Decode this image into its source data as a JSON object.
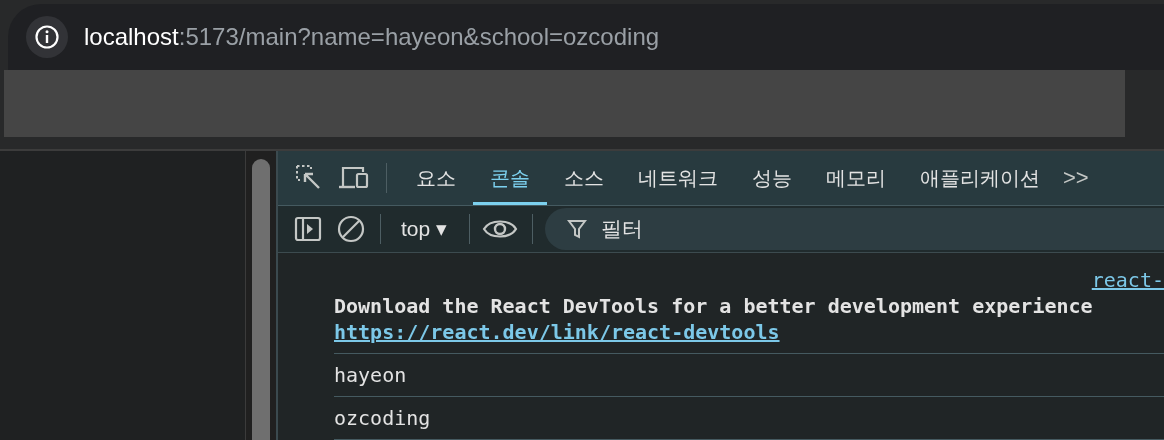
{
  "address_bar": {
    "host": "localhost",
    "path": ":5173/main?name=hayeon&school=ozcoding"
  },
  "devtools": {
    "tabs": [
      {
        "label": "요소",
        "selected": false
      },
      {
        "label": "콘솔",
        "selected": true
      },
      {
        "label": "소스",
        "selected": false
      },
      {
        "label": "네트워크",
        "selected": false
      },
      {
        "label": "성능",
        "selected": false
      },
      {
        "label": "메모리",
        "selected": false
      },
      {
        "label": "애플리케이션",
        "selected": false
      }
    ],
    "more_tabs": ">>",
    "context": "top ▾",
    "filter": {
      "placeholder": "필터"
    },
    "console": {
      "source_link": "react-",
      "messages": [
        {
          "kind": "info",
          "text": "Download the React DevTools for a better development experience",
          "link": "https://react.dev/link/react-devtools"
        },
        {
          "kind": "log",
          "text": "hayeon"
        },
        {
          "kind": "log",
          "text": "ozcoding"
        }
      ]
    }
  }
}
